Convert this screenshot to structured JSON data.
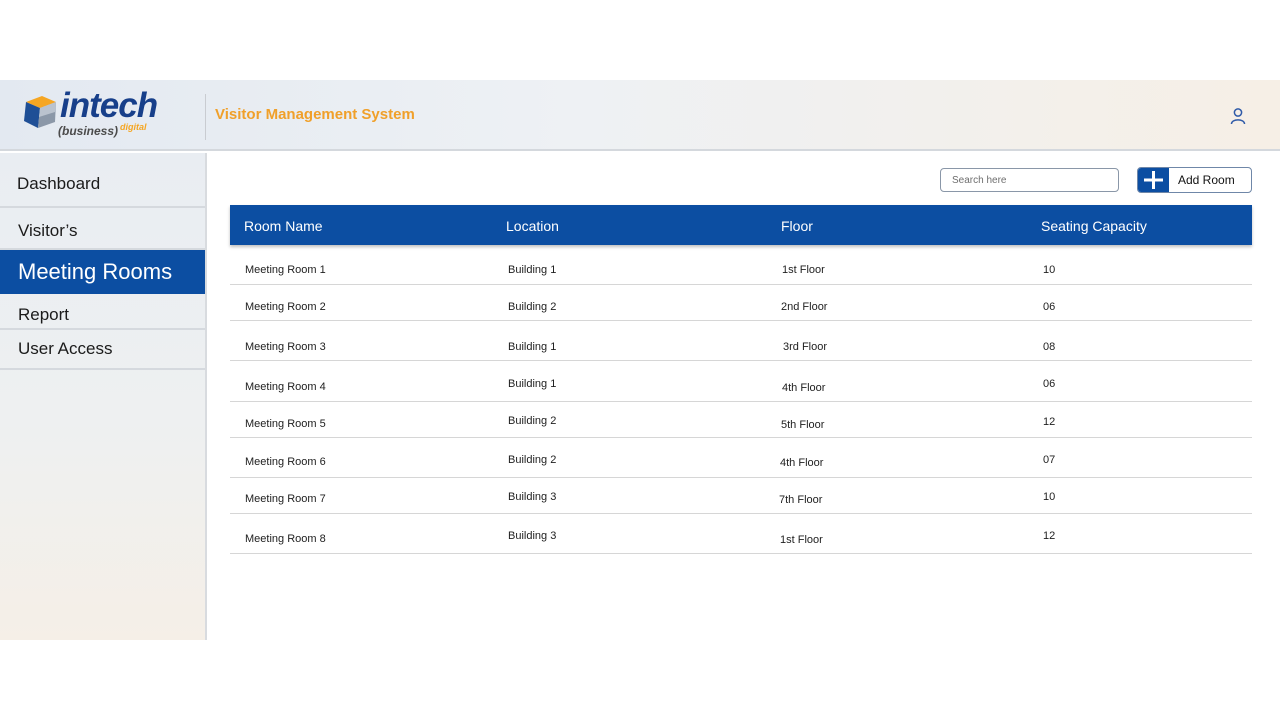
{
  "header": {
    "logo": {
      "word": "intech",
      "sub": "(business)",
      "tag": "digital"
    },
    "app_title": "Visitor Management System",
    "user_icon": "user-icon"
  },
  "sidebar": {
    "items": [
      {
        "label": "Dashboard",
        "active": false
      },
      {
        "label": "Visitor’s",
        "active": false
      },
      {
        "label": "Meeting Rooms",
        "active": true
      },
      {
        "label": "Report",
        "active": false
      },
      {
        "label": "User Access",
        "active": false
      }
    ]
  },
  "toolbar": {
    "search_placeholder": "Search here",
    "search_value": "",
    "add_label": "Add Room",
    "add_icon": "plus-icon"
  },
  "table": {
    "columns": [
      "Room Name",
      "Location",
      "Floor",
      "Seating Capacity"
    ],
    "rows": [
      [
        "Meeting Room 1",
        "Building 1",
        "1st Floor",
        "10"
      ],
      [
        "Meeting Room 2",
        "Building 2",
        "2nd Floor",
        "06"
      ],
      [
        "Meeting Room 3",
        "Building 1",
        "3rd Floor",
        "08"
      ],
      [
        "Meeting Room 4",
        "Building 1",
        "4th Floor",
        "06"
      ],
      [
        "Meeting Room 5",
        "Building 2",
        "5th Floor",
        "12"
      ],
      [
        "Meeting Room 6",
        "Building 2",
        "4th Floor",
        "07"
      ],
      [
        "Meeting Room 7",
        "Building 3",
        "7th Floor",
        "10"
      ],
      [
        "Meeting Room 8",
        "Building 3",
        "1st Floor",
        "12"
      ]
    ]
  },
  "colors": {
    "primary": "#0c4ea2",
    "accent": "#f0a02a",
    "logo_blue": "#173f8a"
  }
}
